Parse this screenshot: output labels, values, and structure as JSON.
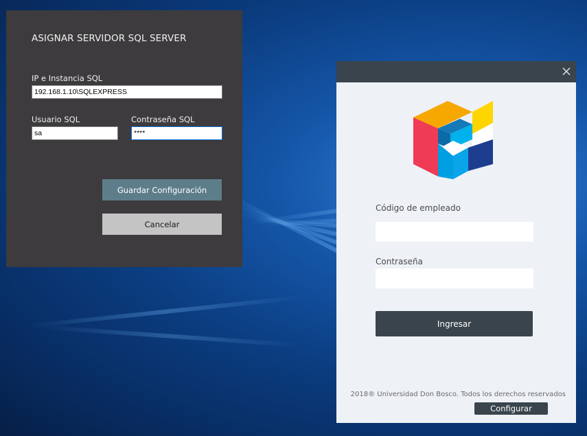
{
  "sql_dialog": {
    "title": "ASIGNAR SERVIDOR SQL SERVER",
    "instance_label": "IP e Instancia SQL",
    "instance_value": "192.168.1.10\\SQLEXPRESS",
    "user_label": "Usuario SQL",
    "user_value": "sa",
    "password_label": "Contraseña SQL",
    "password_value": "****",
    "save_label": "Guardar Configuración",
    "cancel_label": "Cancelar"
  },
  "login": {
    "close_icon": "close-icon",
    "employee_code_label": "Código de empleado",
    "employee_code_value": "",
    "password_label": "Contraseña",
    "password_value": "",
    "login_label": "Ingresar",
    "footer": "2018® Universidad Don Bosco. Todos los derechos reservados",
    "configure_label": "Configurar"
  },
  "colors": {
    "sql_dialog_bg": "#3d3b3d",
    "save_button_bg": "#5e7d8b",
    "cancel_button_bg": "#c4c4c4",
    "login_bg": "#eef2f6",
    "login_titlebar_bg": "#3a444c",
    "logo_orange": "#f7a800",
    "logo_yellow": "#ffd500",
    "logo_red": "#ef3b55",
    "logo_blue": "#009ee3",
    "logo_dark_blue": "#1d3e8f"
  }
}
